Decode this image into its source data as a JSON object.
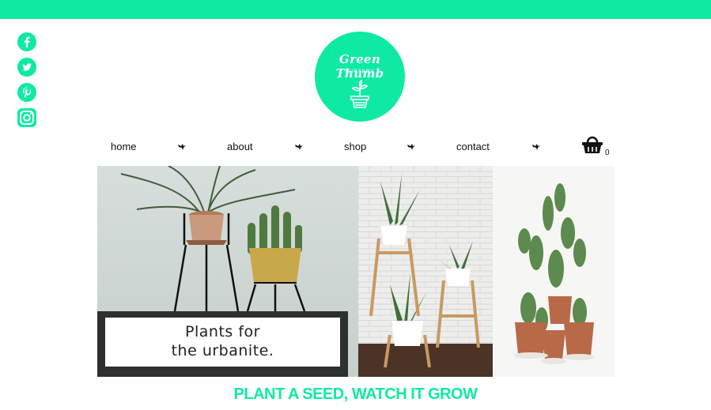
{
  "brand": {
    "name": "Green Thumb",
    "subtitle": "NURSERY",
    "accent": "#0eeaa3"
  },
  "social": [
    {
      "name": "facebook-icon"
    },
    {
      "name": "twitter-icon"
    },
    {
      "name": "pinterest-icon"
    },
    {
      "name": "instagram-icon"
    }
  ],
  "nav": {
    "items": [
      "home",
      "about",
      "shop",
      "contact"
    ],
    "separator_icon": "bird-icon",
    "cart_icon": "basket-icon",
    "cart_count": "0"
  },
  "hero": {
    "caption_line1": "Plants for",
    "caption_line2": "the urbanite."
  },
  "tagline": "PLANT A SEED, WATCH IT GROW"
}
